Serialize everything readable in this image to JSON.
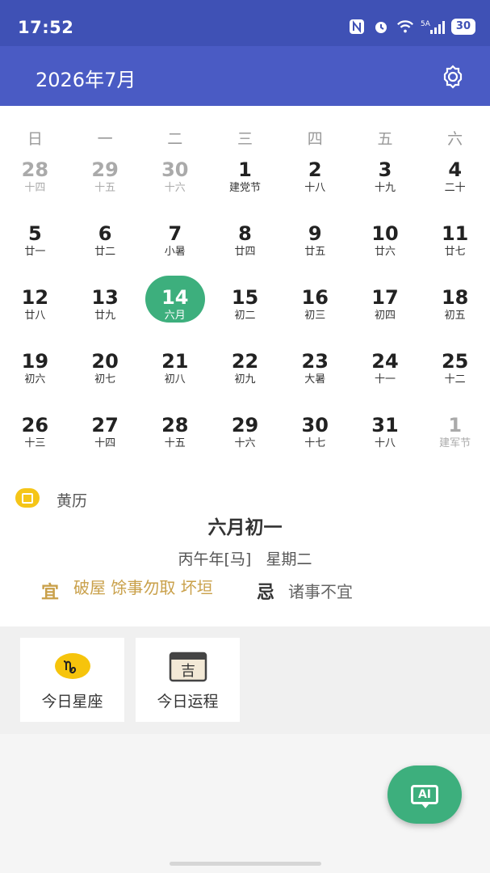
{
  "status": {
    "time": "17:52",
    "battery": "30",
    "network": "5A"
  },
  "header": {
    "title": "2026年7月"
  },
  "weekdays": [
    "日",
    "一",
    "二",
    "三",
    "四",
    "五",
    "六"
  ],
  "calendar": {
    "weeks": [
      [
        {
          "d": "28",
          "l": "十四",
          "other": true
        },
        {
          "d": "29",
          "l": "十五",
          "other": true
        },
        {
          "d": "30",
          "l": "十六",
          "other": true
        },
        {
          "d": "1",
          "l": "建党节"
        },
        {
          "d": "2",
          "l": "十八"
        },
        {
          "d": "3",
          "l": "十九"
        },
        {
          "d": "4",
          "l": "二十"
        }
      ],
      [
        {
          "d": "5",
          "l": "廿一"
        },
        {
          "d": "6",
          "l": "廿二"
        },
        {
          "d": "7",
          "l": "小暑"
        },
        {
          "d": "8",
          "l": "廿四"
        },
        {
          "d": "9",
          "l": "廿五"
        },
        {
          "d": "10",
          "l": "廿六"
        },
        {
          "d": "11",
          "l": "廿七"
        }
      ],
      [
        {
          "d": "12",
          "l": "廿八"
        },
        {
          "d": "13",
          "l": "廿九"
        },
        {
          "d": "14",
          "l": "六月",
          "today": true
        },
        {
          "d": "15",
          "l": "初二"
        },
        {
          "d": "16",
          "l": "初三"
        },
        {
          "d": "17",
          "l": "初四"
        },
        {
          "d": "18",
          "l": "初五"
        }
      ],
      [
        {
          "d": "19",
          "l": "初六"
        },
        {
          "d": "20",
          "l": "初七"
        },
        {
          "d": "21",
          "l": "初八"
        },
        {
          "d": "22",
          "l": "初九"
        },
        {
          "d": "23",
          "l": "大暑"
        },
        {
          "d": "24",
          "l": "十一"
        },
        {
          "d": "25",
          "l": "十二"
        }
      ],
      [
        {
          "d": "26",
          "l": "十三"
        },
        {
          "d": "27",
          "l": "十四"
        },
        {
          "d": "28",
          "l": "十五"
        },
        {
          "d": "29",
          "l": "十六"
        },
        {
          "d": "30",
          "l": "十七"
        },
        {
          "d": "31",
          "l": "十八"
        },
        {
          "d": "1",
          "l": "建军节",
          "other": true
        }
      ]
    ]
  },
  "almanac": {
    "label": "黄历",
    "lunar_date": "六月初一",
    "year_week": "丙午年[马]   星期二",
    "yi_char": "宜",
    "yi_text": "破屋 馀事勿取 坏垣",
    "ji_char": "忌",
    "ji_text": "诸事不宜"
  },
  "tools": {
    "horoscope_label": "今日星座",
    "fortune_label": "今日运程",
    "fortune_char": "吉"
  },
  "fab": {
    "label": "AI"
  },
  "colors": {
    "primary": "#4a5bc4",
    "statusbar": "#3f51b5",
    "accent": "#3daf7d",
    "yi": "#c9a04a"
  }
}
